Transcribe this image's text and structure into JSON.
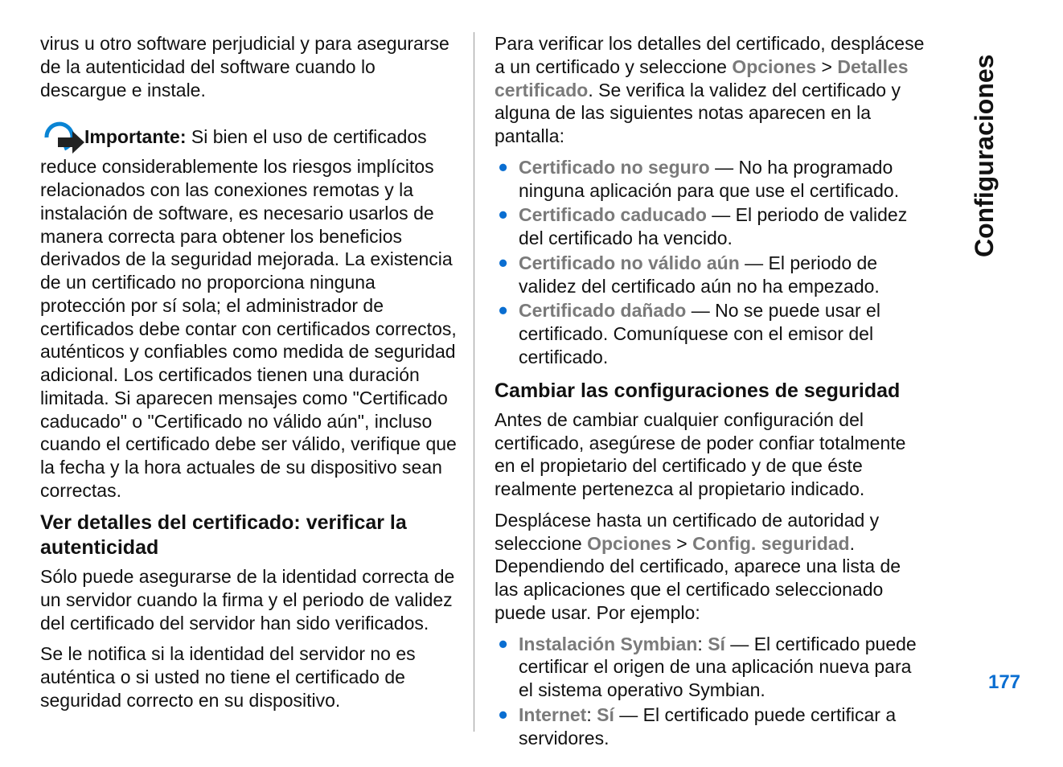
{
  "sidebar": {
    "section_title": "Configuraciones",
    "page_number": "177"
  },
  "left": {
    "p1": "virus u otro software perjudicial y para asegurarse de la autenticidad del software cuando lo descargue e instale.",
    "important_label": "Importante:",
    "important_text": "  Si bien el uso de certificados reduce considerablemente los riesgos implícitos relacionados con las conexiones remotas y la instalación de software, es necesario usarlos de manera correcta para obtener los beneficios derivados de la seguridad mejorada. La existencia de un certificado no proporciona ninguna protección por sí sola; el administrador de certificados debe contar con certificados correctos, auténticos y confiables como medida de seguridad adicional. Los certificados tienen una duración limitada. Si aparecen mensajes como \"Certificado caducado\" o \"Certificado no válido aún\", incluso cuando el certificado debe ser válido, verifique que la fecha y la hora actuales de su dispositivo sean correctas.",
    "h1": "Ver detalles del certificado: verificar la autenticidad",
    "p2": "Sólo puede asegurarse de la identidad correcta de un servidor cuando la firma y el periodo de validez del certificado del servidor han sido verificados.",
    "p3": "Se le notifica si la identidad del servidor no es auténtica o si usted no tiene el certificado de seguridad correcto en su dispositivo."
  },
  "right": {
    "p1a": "Para verificar los detalles del certificado, desplácese a un certificado y seleccione ",
    "menu1": "Opciones",
    "sep": " > ",
    "menu2": "Detalles certificado",
    "p1b": ". Se verifica la validez del certificado y alguna de las siguientes notas aparecen en la pantalla:",
    "bullets1": [
      {
        "term": "Certificado no seguro",
        "desc": " — No ha programado ninguna aplicación para que use el certificado."
      },
      {
        "term": "Certificado caducado",
        "desc": " — El periodo de validez del certificado ha vencido."
      },
      {
        "term": "Certificado no válido aún",
        "desc": " — El periodo de validez del certificado aún no ha empezado."
      },
      {
        "term": "Certificado dañado",
        "desc": " — No se puede usar el certificado. Comuníquese con el emisor del certificado."
      }
    ],
    "h2": "Cambiar las configuraciones de seguridad",
    "p2": "Antes de cambiar cualquier configuración del certificado, asegúrese de poder confiar totalmente en el propietario del certificado y de que éste realmente pertenezca al propietario indicado.",
    "p3a": "Desplácese hasta un certificado de autoridad y seleccione ",
    "menu3": "Opciones",
    "menu4": "Config. seguridad",
    "p3b": ". Dependiendo del certificado, aparece una lista de las aplicaciones que el certificado seleccionado puede usar. Por ejemplo:",
    "bullets2": [
      {
        "term": "Instalación Symbian",
        "val": "Sí",
        "desc": " — El certificado puede certificar el origen de una aplicación nueva para el sistema operativo Symbian."
      },
      {
        "term": "Internet",
        "val": "Sí",
        "desc": " — El certificado puede certificar a servidores."
      }
    ]
  }
}
